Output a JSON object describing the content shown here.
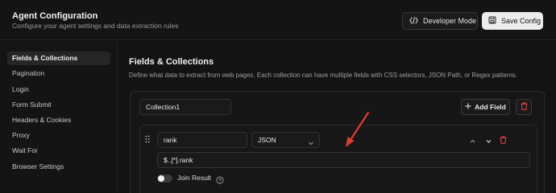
{
  "header": {
    "title": "Agent Configuration",
    "subtitle": "Configure your agent settings and data extraction rules",
    "developer_mode_label": "Developer Mode",
    "save_label": "Save Config"
  },
  "sidebar": {
    "items": [
      {
        "label": "Fields & Collections",
        "active": true
      },
      {
        "label": "Pagination"
      },
      {
        "label": "Login"
      },
      {
        "label": "Form Submit"
      },
      {
        "label": "Headers & Cookies"
      },
      {
        "label": "Proxy"
      },
      {
        "label": "Wait For"
      },
      {
        "label": "Browser Settings"
      }
    ]
  },
  "main": {
    "title": "Fields & Collections",
    "description": "Define what data to extract from web pages. Each collection can have multiple fields with CSS selectors, JSON Path, or Regex patterns.",
    "collection": {
      "name": "Collection1",
      "add_field_label": "Add Field",
      "field": {
        "name": "rank",
        "type": "JSON",
        "selector": "$..[*].rank",
        "join_result_label": "Join Result",
        "join_result": false
      }
    }
  },
  "colors": {
    "background": "#121212",
    "accent_delete": "#e5484d",
    "annotation_arrow": "#e03a2f",
    "primary_button": "#ececec"
  }
}
